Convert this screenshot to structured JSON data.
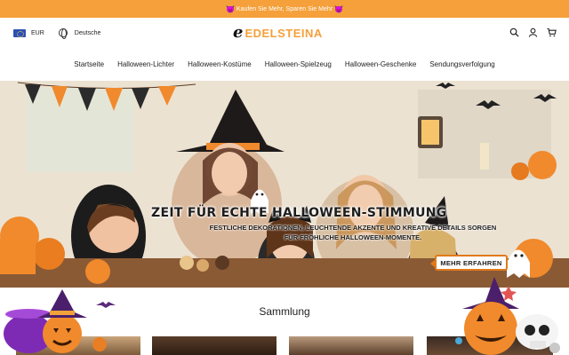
{
  "announcement": {
    "text": "Kaufen Sie Mehr, Sparen Sie Mehr",
    "emoji": "😈"
  },
  "header": {
    "currency": "EUR",
    "language": "Deutsche",
    "logo_text": "EDELSTEINA",
    "logo_mark": "e",
    "icons": [
      "search-icon",
      "user-icon",
      "cart-icon"
    ]
  },
  "nav": {
    "items": [
      "Startseite",
      "Halloween-Lichter",
      "Halloween-Kostüme",
      "Halloween-Spielzeug",
      "Halloween-Geschenke",
      "Sendungsverfolgung"
    ]
  },
  "hero": {
    "title": "ZEIT FÜR ECHTE HALLOWEEN-STIMMUNG",
    "subtitle": "FESTLICHE DEKORATIONEN, LEUCHTENDE AKZENTE UND KREATIVE DETAILS SORGEN FÜR FRÖHLICHE HALLOWEEN-MOMENTE.",
    "button": "MEHR ERFAHREN"
  },
  "collection": {
    "title": "Sammlung"
  },
  "colors": {
    "accent": "#f5a03b",
    "button_border": "#e07a1a",
    "text": "#222222"
  }
}
